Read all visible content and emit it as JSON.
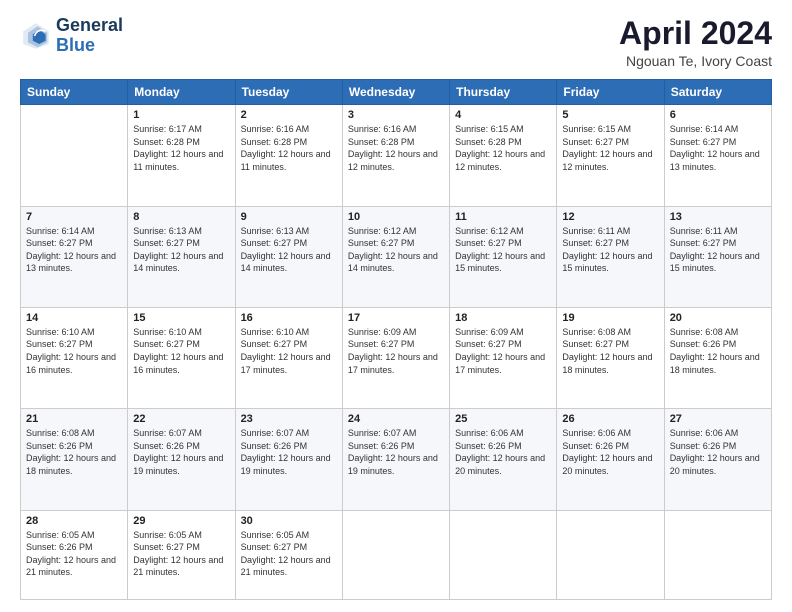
{
  "logo": {
    "line1": "General",
    "line2": "Blue"
  },
  "title": "April 2024",
  "subtitle": "Ngouan Te, Ivory Coast",
  "header_days": [
    "Sunday",
    "Monday",
    "Tuesday",
    "Wednesday",
    "Thursday",
    "Friday",
    "Saturday"
  ],
  "weeks": [
    [
      {
        "day": "",
        "sunrise": "",
        "sunset": "",
        "daylight": ""
      },
      {
        "day": "1",
        "sunrise": "Sunrise: 6:17 AM",
        "sunset": "Sunset: 6:28 PM",
        "daylight": "Daylight: 12 hours and 11 minutes."
      },
      {
        "day": "2",
        "sunrise": "Sunrise: 6:16 AM",
        "sunset": "Sunset: 6:28 PM",
        "daylight": "Daylight: 12 hours and 11 minutes."
      },
      {
        "day": "3",
        "sunrise": "Sunrise: 6:16 AM",
        "sunset": "Sunset: 6:28 PM",
        "daylight": "Daylight: 12 hours and 12 minutes."
      },
      {
        "day": "4",
        "sunrise": "Sunrise: 6:15 AM",
        "sunset": "Sunset: 6:28 PM",
        "daylight": "Daylight: 12 hours and 12 minutes."
      },
      {
        "day": "5",
        "sunrise": "Sunrise: 6:15 AM",
        "sunset": "Sunset: 6:27 PM",
        "daylight": "Daylight: 12 hours and 12 minutes."
      },
      {
        "day": "6",
        "sunrise": "Sunrise: 6:14 AM",
        "sunset": "Sunset: 6:27 PM",
        "daylight": "Daylight: 12 hours and 13 minutes."
      }
    ],
    [
      {
        "day": "7",
        "sunrise": "Sunrise: 6:14 AM",
        "sunset": "Sunset: 6:27 PM",
        "daylight": "Daylight: 12 hours and 13 minutes."
      },
      {
        "day": "8",
        "sunrise": "Sunrise: 6:13 AM",
        "sunset": "Sunset: 6:27 PM",
        "daylight": "Daylight: 12 hours and 14 minutes."
      },
      {
        "day": "9",
        "sunrise": "Sunrise: 6:13 AM",
        "sunset": "Sunset: 6:27 PM",
        "daylight": "Daylight: 12 hours and 14 minutes."
      },
      {
        "day": "10",
        "sunrise": "Sunrise: 6:12 AM",
        "sunset": "Sunset: 6:27 PM",
        "daylight": "Daylight: 12 hours and 14 minutes."
      },
      {
        "day": "11",
        "sunrise": "Sunrise: 6:12 AM",
        "sunset": "Sunset: 6:27 PM",
        "daylight": "Daylight: 12 hours and 15 minutes."
      },
      {
        "day": "12",
        "sunrise": "Sunrise: 6:11 AM",
        "sunset": "Sunset: 6:27 PM",
        "daylight": "Daylight: 12 hours and 15 minutes."
      },
      {
        "day": "13",
        "sunrise": "Sunrise: 6:11 AM",
        "sunset": "Sunset: 6:27 PM",
        "daylight": "Daylight: 12 hours and 15 minutes."
      }
    ],
    [
      {
        "day": "14",
        "sunrise": "Sunrise: 6:10 AM",
        "sunset": "Sunset: 6:27 PM",
        "daylight": "Daylight: 12 hours and 16 minutes."
      },
      {
        "day": "15",
        "sunrise": "Sunrise: 6:10 AM",
        "sunset": "Sunset: 6:27 PM",
        "daylight": "Daylight: 12 hours and 16 minutes."
      },
      {
        "day": "16",
        "sunrise": "Sunrise: 6:10 AM",
        "sunset": "Sunset: 6:27 PM",
        "daylight": "Daylight: 12 hours and 17 minutes."
      },
      {
        "day": "17",
        "sunrise": "Sunrise: 6:09 AM",
        "sunset": "Sunset: 6:27 PM",
        "daylight": "Daylight: 12 hours and 17 minutes."
      },
      {
        "day": "18",
        "sunrise": "Sunrise: 6:09 AM",
        "sunset": "Sunset: 6:27 PM",
        "daylight": "Daylight: 12 hours and 17 minutes."
      },
      {
        "day": "19",
        "sunrise": "Sunrise: 6:08 AM",
        "sunset": "Sunset: 6:27 PM",
        "daylight": "Daylight: 12 hours and 18 minutes."
      },
      {
        "day": "20",
        "sunrise": "Sunrise: 6:08 AM",
        "sunset": "Sunset: 6:26 PM",
        "daylight": "Daylight: 12 hours and 18 minutes."
      }
    ],
    [
      {
        "day": "21",
        "sunrise": "Sunrise: 6:08 AM",
        "sunset": "Sunset: 6:26 PM",
        "daylight": "Daylight: 12 hours and 18 minutes."
      },
      {
        "day": "22",
        "sunrise": "Sunrise: 6:07 AM",
        "sunset": "Sunset: 6:26 PM",
        "daylight": "Daylight: 12 hours and 19 minutes."
      },
      {
        "day": "23",
        "sunrise": "Sunrise: 6:07 AM",
        "sunset": "Sunset: 6:26 PM",
        "daylight": "Daylight: 12 hours and 19 minutes."
      },
      {
        "day": "24",
        "sunrise": "Sunrise: 6:07 AM",
        "sunset": "Sunset: 6:26 PM",
        "daylight": "Daylight: 12 hours and 19 minutes."
      },
      {
        "day": "25",
        "sunrise": "Sunrise: 6:06 AM",
        "sunset": "Sunset: 6:26 PM",
        "daylight": "Daylight: 12 hours and 20 minutes."
      },
      {
        "day": "26",
        "sunrise": "Sunrise: 6:06 AM",
        "sunset": "Sunset: 6:26 PM",
        "daylight": "Daylight: 12 hours and 20 minutes."
      },
      {
        "day": "27",
        "sunrise": "Sunrise: 6:06 AM",
        "sunset": "Sunset: 6:26 PM",
        "daylight": "Daylight: 12 hours and 20 minutes."
      }
    ],
    [
      {
        "day": "28",
        "sunrise": "Sunrise: 6:05 AM",
        "sunset": "Sunset: 6:26 PM",
        "daylight": "Daylight: 12 hours and 21 minutes."
      },
      {
        "day": "29",
        "sunrise": "Sunrise: 6:05 AM",
        "sunset": "Sunset: 6:27 PM",
        "daylight": "Daylight: 12 hours and 21 minutes."
      },
      {
        "day": "30",
        "sunrise": "Sunrise: 6:05 AM",
        "sunset": "Sunset: 6:27 PM",
        "daylight": "Daylight: 12 hours and 21 minutes."
      },
      {
        "day": "",
        "sunrise": "",
        "sunset": "",
        "daylight": ""
      },
      {
        "day": "",
        "sunrise": "",
        "sunset": "",
        "daylight": ""
      },
      {
        "day": "",
        "sunrise": "",
        "sunset": "",
        "daylight": ""
      },
      {
        "day": "",
        "sunrise": "",
        "sunset": "",
        "daylight": ""
      }
    ]
  ]
}
